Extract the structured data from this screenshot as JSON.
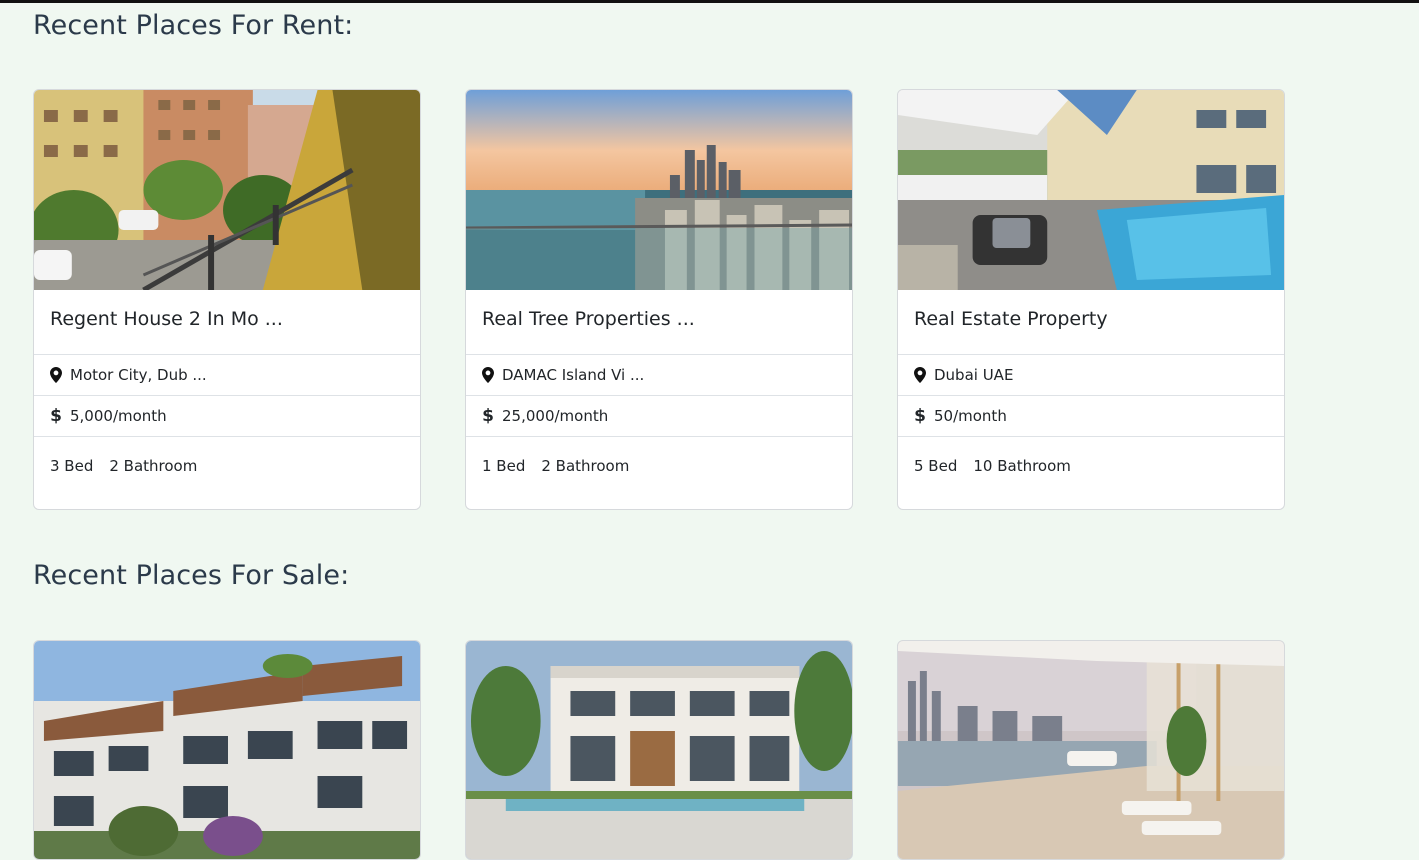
{
  "rent_section": {
    "title": "Recent Places For Rent:",
    "cards": [
      {
        "title": "Regent House 2 In Mo ...",
        "location": "Motor City, Dub ...",
        "price": "5,000/month",
        "beds": "3 Bed",
        "baths": "2 Bathroom",
        "image": "apartment-balcony-view"
      },
      {
        "title": "Real Tree Properties ...",
        "location": "DAMAC Island Vi ...",
        "price": "25,000/month",
        "beds": "1 Bed",
        "baths": "2 Bathroom",
        "image": "dubai-marina-skyline"
      },
      {
        "title": "Real Estate Property",
        "location": "Dubai UAE",
        "price": "50/month",
        "beds": "5 Bed",
        "baths": "10 Bathroom",
        "image": "villa-pool-terrace"
      }
    ]
  },
  "sale_section": {
    "title": "Recent Places For Sale:",
    "cards": [
      {
        "image": "townhouses-exterior"
      },
      {
        "image": "modern-villa-pool"
      },
      {
        "image": "penthouse-terrace-skyline"
      }
    ]
  },
  "colors": {
    "page_background": "#f0f8f1",
    "heading": "#2b3a4a",
    "card_border": "#d6d9dc"
  },
  "icons": {
    "location": "map-marker-icon",
    "price": "dollar-icon"
  }
}
